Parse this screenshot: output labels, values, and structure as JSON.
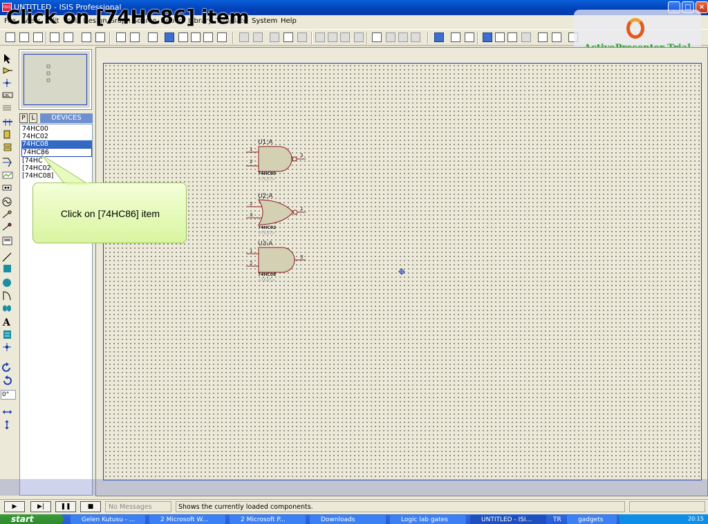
{
  "window": {
    "title": "UNTITLED - ISIS Professional",
    "app_icon": "ISIS"
  },
  "caption": "Click on [74HC86] item",
  "menu": {
    "items": [
      "File",
      "View",
      "Edit",
      "Tools",
      "Design",
      "Graph",
      "Source",
      "Debug",
      "Library",
      "Template",
      "System",
      "Help"
    ]
  },
  "watermark": {
    "text": "ActivePresenter Trial"
  },
  "devices": {
    "header": "DEVICES",
    "p_label": "P",
    "l_label": "L",
    "items": [
      "74HC00",
      "74HC02",
      "74HC08",
      "74HC86",
      "[74HC",
      "[74HC02",
      "[74HC08]"
    ],
    "selected_index": 2,
    "focused_index": 3
  },
  "schematic": {
    "parts": [
      {
        "refdes": "U1:A",
        "part": "74HC00",
        "placeholder": "<TEXT>",
        "pins": [
          "1",
          "2",
          "3"
        ],
        "gate": "nand"
      },
      {
        "refdes": "U2:A",
        "part": "74HC02",
        "placeholder": "<TEXT>",
        "pins": [
          "2",
          "3",
          "1"
        ],
        "gate": "nor"
      },
      {
        "refdes": "U3:A",
        "part": "74HC08",
        "placeholder": "<TEXT>",
        "pins": [
          "1",
          "2",
          "3"
        ],
        "gate": "and"
      }
    ]
  },
  "callout": {
    "text": "Click on [74HC86] item"
  },
  "rotation": {
    "value": "0°"
  },
  "status": {
    "messages": "No Messages",
    "info": "Shows the currently loaded components."
  },
  "taskbar": {
    "start": "start",
    "tasks": [
      "Gelen Kutusu - ...",
      "2 Microsoft W...",
      "2 Microsoft P...",
      "Downloads",
      "Logic lab gates",
      "UNTITLED - ISI...",
      "gadgets"
    ],
    "tray_lang": "TR",
    "clock": "20:15"
  },
  "colors": {
    "accent": "#316ac5",
    "border_blue": "#1e40c0",
    "callout": "#d8f5a0",
    "gate_fill": "#d4d0b4",
    "gate_stroke": "#8b1a1a"
  }
}
